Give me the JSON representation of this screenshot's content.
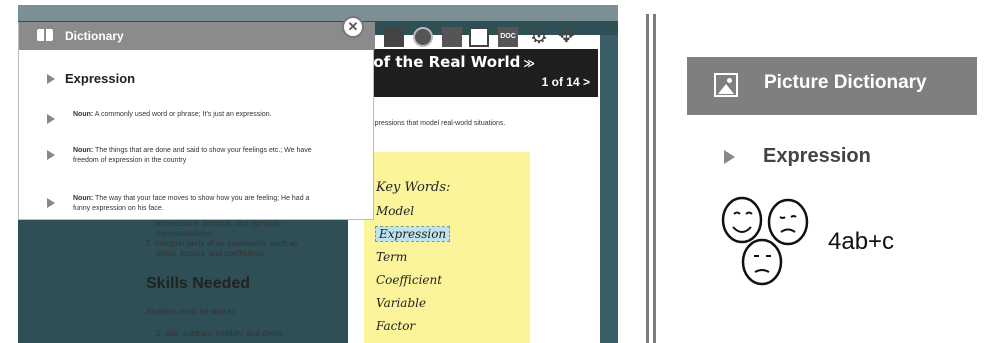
{
  "left": {
    "dictionary": {
      "title": "Dictionary",
      "close": "✕",
      "word": "Expression",
      "definitions": [
        {
          "pos": "Noun:",
          "text": " A commonly used word or phrase; It's just an expression."
        },
        {
          "pos": "Noun:",
          "text": " The things that are done and said to show your feelings etc.; We have freedom of expression in the country"
        },
        {
          "pos": "Noun:",
          "text": " The way that your face moves to show how you are feeling; He had a funny expression on his face."
        }
      ]
    },
    "unit": {
      "title": "ls of the Real World",
      "chevron": "≫",
      "counter": "1 of 14 >",
      "intro": "raic expressions that model real-world situations."
    },
    "toolbar": {
      "doc_label": "DOC",
      "gear": "⚙",
      "move": "✥"
    },
    "content": {
      "line1": "expressions, pictorial, and symbolic",
      "line2": "representations.",
      "line3": "2. Interpret parts of an expression, such as",
      "line4": "terms, factors, and coefficients.",
      "skills_heading": "Skills Needed",
      "students_line": "Students must be able to:",
      "list_item1": "1. add, subtract, multiply, and divide"
    },
    "sticky_note": {
      "title": "Key Words:",
      "words": [
        "Model",
        "Expression",
        "Term",
        "Coefficient",
        "Variable",
        "Factor"
      ]
    }
  },
  "right": {
    "header_title": "Picture Dictionary",
    "word": "Expression",
    "expression": "4ab+c"
  }
}
